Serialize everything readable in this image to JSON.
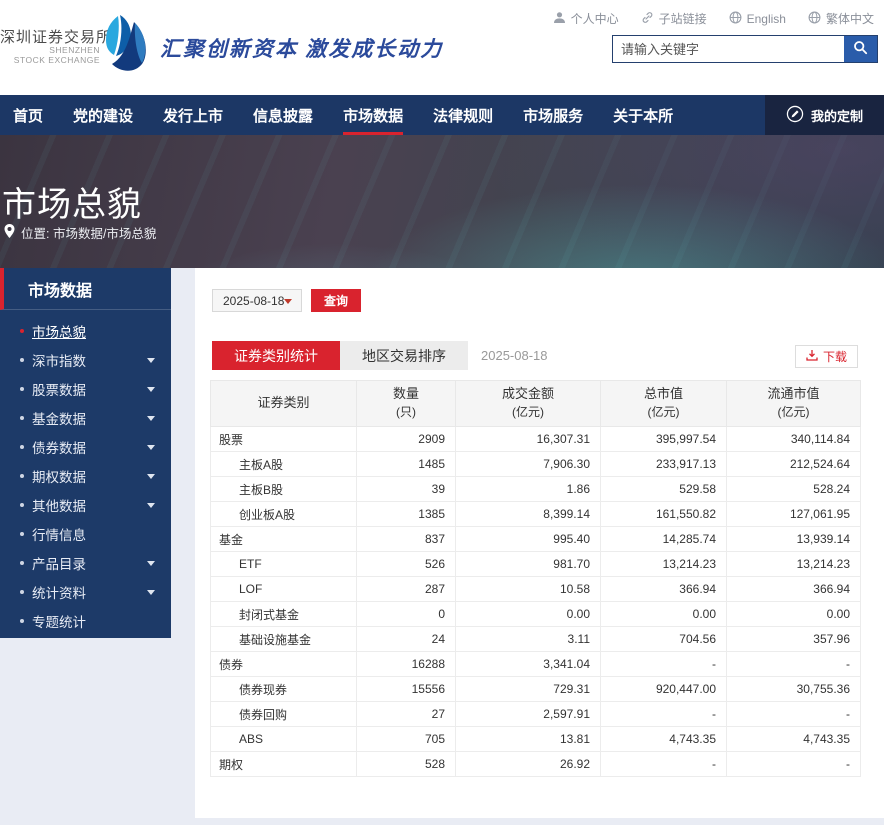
{
  "colors": {
    "accent_red": "#d9232e",
    "nav_blue": "#1c3765",
    "sidebar_blue": "#1d3a68",
    "search_btn_blue": "#2a5caa"
  },
  "header": {
    "logo": {
      "cn": "深圳证券交易所",
      "en_line1": "SHENZHEN",
      "en_line2": "STOCK EXCHANGE",
      "slogan": "汇聚创新资本 激发成长动力"
    },
    "top_links": [
      {
        "label": "个人中心",
        "icon": "user-icon"
      },
      {
        "label": "子站链接",
        "icon": "link-icon"
      },
      {
        "label": "English",
        "icon": "globe-icon"
      },
      {
        "label": "繁体中文",
        "icon": "globe-icon"
      }
    ],
    "search": {
      "placeholder": "请输入关键字",
      "button_icon": "search-icon"
    }
  },
  "nav": {
    "items": [
      {
        "label": "首页",
        "active": false
      },
      {
        "label": "党的建设",
        "active": false
      },
      {
        "label": "发行上市",
        "active": false
      },
      {
        "label": "信息披露",
        "active": false
      },
      {
        "label": "市场数据",
        "active": true
      },
      {
        "label": "法律规则",
        "active": false
      },
      {
        "label": "市场服务",
        "active": false
      },
      {
        "label": "关于本所",
        "active": false
      }
    ],
    "custom_label": "我的定制",
    "custom_icon": "customize-icon"
  },
  "banner": {
    "title": "市场总貌",
    "breadcrumb": "位置: 市场数据/市场总貌",
    "pin_icon": "location-pin-icon"
  },
  "sidebar": {
    "title": "市场数据",
    "items": [
      {
        "label": "市场总貌",
        "active": true,
        "expandable": false
      },
      {
        "label": "深市指数",
        "active": false,
        "expandable": true
      },
      {
        "label": "股票数据",
        "active": false,
        "expandable": true
      },
      {
        "label": "基金数据",
        "active": false,
        "expandable": true
      },
      {
        "label": "债券数据",
        "active": false,
        "expandable": true
      },
      {
        "label": "期权数据",
        "active": false,
        "expandable": true
      },
      {
        "label": "其他数据",
        "active": false,
        "expandable": true
      },
      {
        "label": "行情信息",
        "active": false,
        "expandable": false
      },
      {
        "label": "产品目录",
        "active": false,
        "expandable": true
      },
      {
        "label": "统计资料",
        "active": false,
        "expandable": true
      },
      {
        "label": "专题统计",
        "active": false,
        "expandable": false
      }
    ]
  },
  "main": {
    "date_select": "2025-08-18",
    "query_button": "查询",
    "tabs": [
      {
        "label": "证券类别统计",
        "active": true
      },
      {
        "label": "地区交易排序",
        "active": false
      }
    ],
    "tab_date": "2025-08-18",
    "download_label": "下载",
    "table": {
      "headers": [
        {
          "label": "证券类别",
          "unit": ""
        },
        {
          "label": "数量",
          "unit": "(只)"
        },
        {
          "label": "成交金额",
          "unit": "(亿元)"
        },
        {
          "label": "总市值",
          "unit": "(亿元)"
        },
        {
          "label": "流通市值",
          "unit": "(亿元)"
        }
      ],
      "rows": [
        {
          "category": "股票",
          "level": 0,
          "values": [
            "2909",
            "16,307.31",
            "395,997.54",
            "340,114.84"
          ]
        },
        {
          "category": "主板A股",
          "level": 1,
          "values": [
            "1485",
            "7,906.30",
            "233,917.13",
            "212,524.64"
          ]
        },
        {
          "category": "主板B股",
          "level": 1,
          "values": [
            "39",
            "1.86",
            "529.58",
            "528.24"
          ]
        },
        {
          "category": "创业板A股",
          "level": 1,
          "values": [
            "1385",
            "8,399.14",
            "161,550.82",
            "127,061.95"
          ]
        },
        {
          "category": "基金",
          "level": 0,
          "values": [
            "837",
            "995.40",
            "14,285.74",
            "13,939.14"
          ]
        },
        {
          "category": "ETF",
          "level": 1,
          "values": [
            "526",
            "981.70",
            "13,214.23",
            "13,214.23"
          ]
        },
        {
          "category": "LOF",
          "level": 1,
          "values": [
            "287",
            "10.58",
            "366.94",
            "366.94"
          ]
        },
        {
          "category": "封闭式基金",
          "level": 1,
          "values": [
            "0",
            "0.00",
            "0.00",
            "0.00"
          ]
        },
        {
          "category": "基础设施基金",
          "level": 1,
          "values": [
            "24",
            "3.11",
            "704.56",
            "357.96"
          ]
        },
        {
          "category": "债券",
          "level": 0,
          "values": [
            "16288",
            "3,341.04",
            "-",
            "-"
          ]
        },
        {
          "category": "债券现券",
          "level": 1,
          "values": [
            "15556",
            "729.31",
            "920,447.00",
            "30,755.36"
          ]
        },
        {
          "category": "债券回购",
          "level": 1,
          "values": [
            "27",
            "2,597.91",
            "-",
            "-"
          ]
        },
        {
          "category": "ABS",
          "level": 1,
          "values": [
            "705",
            "13.81",
            "4,743.35",
            "4,743.35"
          ]
        },
        {
          "category": "期权",
          "level": 0,
          "values": [
            "528",
            "26.92",
            "-",
            "-"
          ]
        }
      ]
    }
  }
}
